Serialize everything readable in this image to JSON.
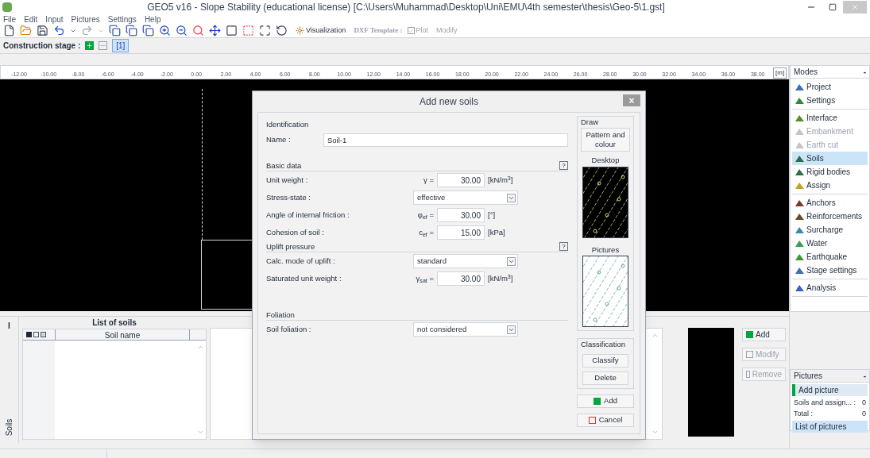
{
  "window": {
    "title": "GEO5 v16 - Slope Stability (educational license) [C:\\Users\\Muhammad\\Desktop\\Uni\\EMU\\4th semester\\thesis\\Geo-5\\1.gst]"
  },
  "menu": [
    "File",
    "Edit",
    "Input",
    "Pictures",
    "Settings",
    "Help"
  ],
  "toolbar": {
    "visualization": "Visualization",
    "dxf_template": "DXF Template :",
    "plot": {
      "label": "Plot",
      "checked": true,
      "disabled": true
    },
    "modify": {
      "label": "Modify",
      "disabled": true
    }
  },
  "construction_stage": {
    "label": "Construction stage :",
    "stages": [
      {
        "label": "[1]",
        "selected": true
      }
    ]
  },
  "ruler": {
    "ticks": [
      "-12.00",
      "-10.00",
      "-8.00",
      "-6.00",
      "-4.00",
      "-2.00",
      "0.00",
      "2.00",
      "4.00",
      "6.00",
      "8.00",
      "10.00",
      "12.00",
      "14.00",
      "16.00",
      "18.00",
      "20.00",
      "22.00",
      "24.00",
      "26.00",
      "28.00",
      "30.00",
      "32.00",
      "34.00",
      "36.00",
      "38.00"
    ],
    "unit": "[m]"
  },
  "modes": {
    "title": "Modes",
    "collapse": "-",
    "groups": [
      [
        {
          "label": "Project",
          "selected": false,
          "disabled": false
        },
        {
          "label": "Settings",
          "selected": false,
          "disabled": false
        }
      ],
      [
        {
          "label": "Interface",
          "selected": false,
          "disabled": false
        },
        {
          "label": "Embankment",
          "selected": false,
          "disabled": true
        },
        {
          "label": "Earth cut",
          "selected": false,
          "disabled": true
        },
        {
          "label": "Soils",
          "selected": true,
          "disabled": false
        },
        {
          "label": "Rigid bodies",
          "selected": false,
          "disabled": false
        },
        {
          "label": "Assign",
          "selected": false,
          "disabled": false
        }
      ],
      [
        {
          "label": "Anchors",
          "selected": false,
          "disabled": false
        },
        {
          "label": "Reinforcements",
          "selected": false,
          "disabled": false
        },
        {
          "label": "Surcharge",
          "selected": false,
          "disabled": false
        },
        {
          "label": "Water",
          "selected": false,
          "disabled": false
        },
        {
          "label": "Earthquake",
          "selected": false,
          "disabled": false
        },
        {
          "label": "Stage settings",
          "selected": false,
          "disabled": false
        }
      ],
      [
        {
          "label": "Analysis",
          "selected": false,
          "disabled": false
        }
      ]
    ]
  },
  "bottom_panel": {
    "side_tab": "Soils",
    "side_marker": "I",
    "list_title": "List of soils",
    "column": "Soil name",
    "buttons": [
      {
        "label": "Add",
        "disabled": false
      },
      {
        "label": "Modify",
        "disabled": true
      },
      {
        "label": "Remove",
        "disabled": true
      }
    ]
  },
  "pictures": {
    "title": "Pictures",
    "collapse": "-",
    "add": "Add picture",
    "rows": [
      {
        "label": "Soils and assign... :",
        "value": "0"
      },
      {
        "label": "Total :",
        "value": "0"
      }
    ],
    "list": "List of pictures"
  },
  "dialog": {
    "title": "Add new soils",
    "identification": "Identification",
    "name_label": "Name :",
    "name_value": "Soil-1",
    "sections": [
      {
        "title": "Basic data",
        "help": "?",
        "rows": [
          {
            "kind": "number",
            "label": "Unit weight :",
            "symbol": "γ =",
            "value": "30.00",
            "unit": "[kN/m$^{3}$]"
          },
          {
            "kind": "select",
            "label": "Stress-state :",
            "value": "effective"
          },
          {
            "kind": "number",
            "label": "Angle of internal friction :",
            "symbol": "φ$_{ef}$ =",
            "value": "30.00",
            "unit": "[°]"
          },
          {
            "kind": "number",
            "label": "Cohesion of soil :",
            "symbol": "c$_{ef}$ =",
            "value": "15.00",
            "unit": "[kPa]"
          }
        ]
      },
      {
        "title": "Uplift pressure",
        "help": "?",
        "rows": [
          {
            "kind": "select",
            "label": "Calc. mode of uplift :",
            "value": "standard"
          },
          {
            "kind": "number",
            "label": "Saturated unit weight :",
            "symbol": "γ$_{sat}$ =",
            "value": "30.00",
            "unit": "[kN/m$^{3}$]"
          }
        ]
      },
      {
        "title": "Foliation",
        "rows": [
          {
            "kind": "select",
            "label": "Soil foliation :",
            "value": "not considered"
          }
        ]
      }
    ],
    "draw": "Draw",
    "pattern_button": "Pattern and colour",
    "desktop": "Desktop",
    "pictures": "Pictures",
    "classification": "Classification",
    "classify": "Classify",
    "delete": "Delete",
    "add": "Add",
    "cancel": "Cancel",
    "close": "×"
  }
}
